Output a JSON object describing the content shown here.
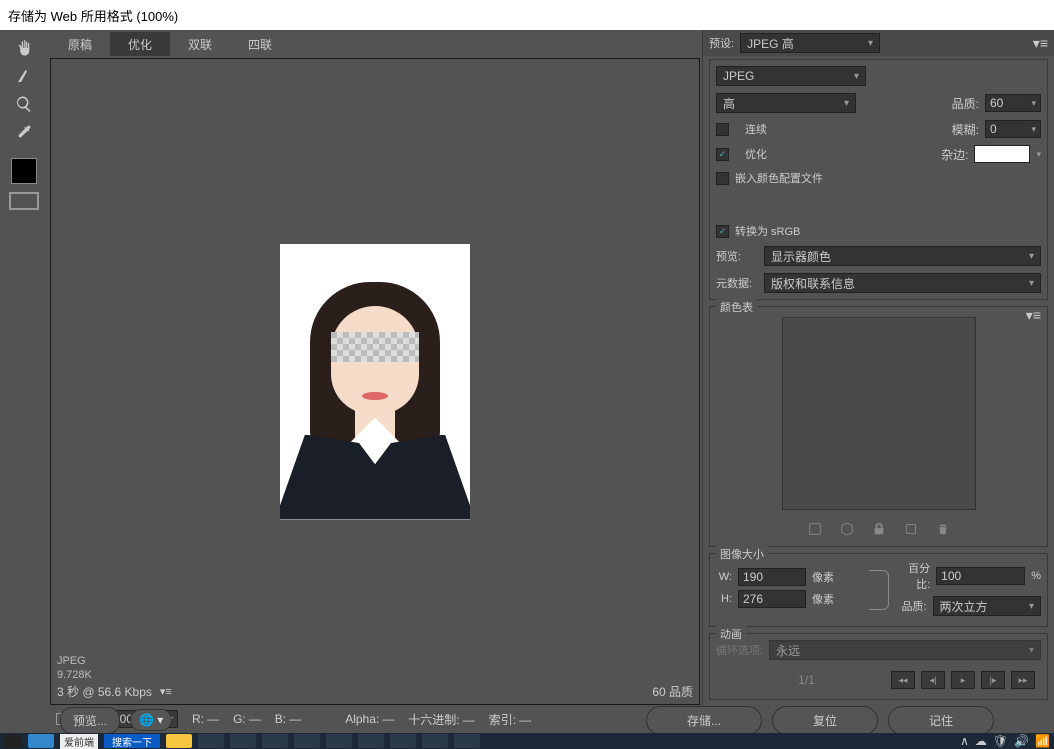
{
  "title": "存储为 Web 所用格式 (100%)",
  "tabs": {
    "t0": "原稿",
    "t1": "优化",
    "t2": "双联",
    "t3": "四联"
  },
  "preview_info": {
    "format": "JPEG",
    "size": "9.728K",
    "speed": "3 秒 @ 56.6 Kbps",
    "quality_label": "60 品质"
  },
  "zoom": "100%",
  "channels": {
    "r": "R:",
    "g": "G:",
    "b": "B:",
    "a": "Alpha:",
    "hex": "十六进制:",
    "idx": "索引:",
    "dash": "—"
  },
  "right": {
    "preset_label": "预设:",
    "preset": "JPEG 高",
    "format": "JPEG",
    "quality_sel": "高",
    "quality_label": "品质:",
    "quality_val": "60",
    "progressive": "连续",
    "blur_label": "模糊:",
    "blur_val": "0",
    "optimized": "优化",
    "matte_label": "杂边:",
    "embed": "嵌入颜色配置文件",
    "convert": "转换为 sRGB",
    "preview_label": "预览:",
    "preview_val": "显示器颜色",
    "meta_label": "元数据:",
    "meta_val": "版权和联系信息",
    "colortable_title": "颜色表",
    "imgsize_title": "图像大小",
    "w": "W:",
    "h": "H:",
    "wv": "190",
    "hv": "276",
    "unit": "像素",
    "percent_label": "百分比:",
    "percent_val": "100",
    "percent_unit": "%",
    "resample_label": "品质:",
    "resample_val": "两次立方",
    "anim_title": "动画",
    "loop_label": "循环选项:",
    "loop_val": "永远",
    "frames": "1/1"
  },
  "footer": {
    "preview": "预览...",
    "save": "存储...",
    "reset": "复位",
    "remember": "记住"
  },
  "taskbar": {
    "search": "搜索一下",
    "app": "爱前端"
  }
}
